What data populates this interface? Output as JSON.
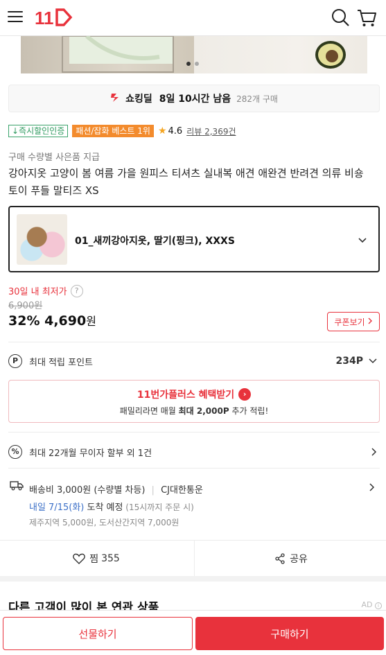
{
  "header": {
    "logo_text": "11",
    "icons": [
      "menu-icon",
      "search-icon",
      "cart-icon"
    ]
  },
  "carousel": {
    "total": 2,
    "current": 1
  },
  "deal": {
    "label": "쇼킹딜",
    "time_left": "8일 10시간 남음",
    "purchase_count": "282개 구매"
  },
  "badges": {
    "instant_discount": "↓즉시할인인증",
    "best": "패션/잡화 베스트 1위",
    "rating": "4.6",
    "review_prefix": "리뷰",
    "review_count": "2,369건"
  },
  "product": {
    "gift_note": "구매 수량별 사은품 지급",
    "title": "강아지옷 고양이 봄 여름 가을 원피스 티셔츠 실내복 애견 애완견 반려견 의류 비숑 토이 푸들 말티즈 XS"
  },
  "option": {
    "selected": "01_새끼강아지옷, 딸기(핑크), XXXS"
  },
  "price": {
    "lowest_label": "30일 내 최저가",
    "original": "6,900원",
    "discount": "32%",
    "sale": "4,690",
    "currency": "원",
    "coupon_label": "쿠폰보기"
  },
  "points": {
    "label": "최대 적립 포인트",
    "value": "234P",
    "icon": "P"
  },
  "plus": {
    "title": "11번가플러스 혜택받기",
    "desc_prefix": "패밀리라면 매월 ",
    "desc_bold": "최대 2,000P",
    "desc_suffix": " 추가 적립!"
  },
  "installment": {
    "text": "최대 22개월 무이자 할부 외 1건",
    "icon": "%"
  },
  "shipping": {
    "fee": "배송비 3,000원 (수량별 차등)",
    "carrier": "CJ대한통운",
    "arrival_date": "내일 7/15(화)",
    "arrival_text": " 도착 예정",
    "arrival_note": " (15시까지 주문 시)",
    "extra": "제주지역 5,000원, 도서산간지역 7,000원"
  },
  "actions": {
    "like_label": "찜",
    "like_count": "355",
    "share_label": "공유"
  },
  "related": {
    "title": "다른 고객이 많이 본 연관 상품",
    "ad_label": "AD"
  },
  "buttons": {
    "gift": "선물하기",
    "buy": "구매하기"
  },
  "colors": {
    "brand_red": "#e8323c",
    "blue": "#3c70c8",
    "green": "#2e9a5f",
    "orange": "#f38b2d"
  }
}
